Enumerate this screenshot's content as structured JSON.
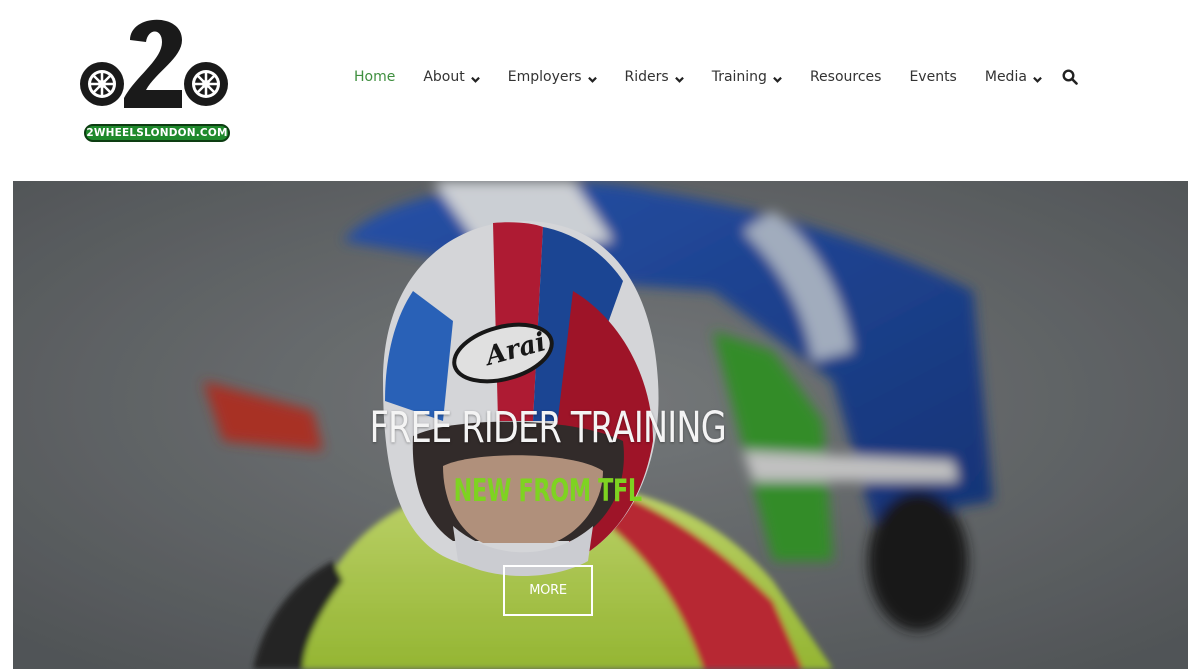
{
  "logo": {
    "mark": "o2o",
    "badge_text": "2WHEELSLONDON.COM"
  },
  "nav": {
    "items": [
      {
        "label": "Home",
        "active": true,
        "dropdown": false
      },
      {
        "label": "About",
        "active": false,
        "dropdown": true
      },
      {
        "label": "Employers",
        "active": false,
        "dropdown": true
      },
      {
        "label": "Riders",
        "active": false,
        "dropdown": true
      },
      {
        "label": "Training",
        "active": false,
        "dropdown": true
      },
      {
        "label": "Resources",
        "active": false,
        "dropdown": false
      },
      {
        "label": "Events",
        "active": false,
        "dropdown": false
      },
      {
        "label": "Media",
        "active": false,
        "dropdown": true
      }
    ],
    "search_icon": "search-icon"
  },
  "hero": {
    "title": "FREE RIDER TRAINING",
    "subtitle": "NEW FROM TFL",
    "button_label": "MORE",
    "helmet_brand": "Arai"
  },
  "colors": {
    "accent_green": "#7ed321",
    "nav_active": "#3f8f3f",
    "badge_green": "#1f8a2c"
  }
}
